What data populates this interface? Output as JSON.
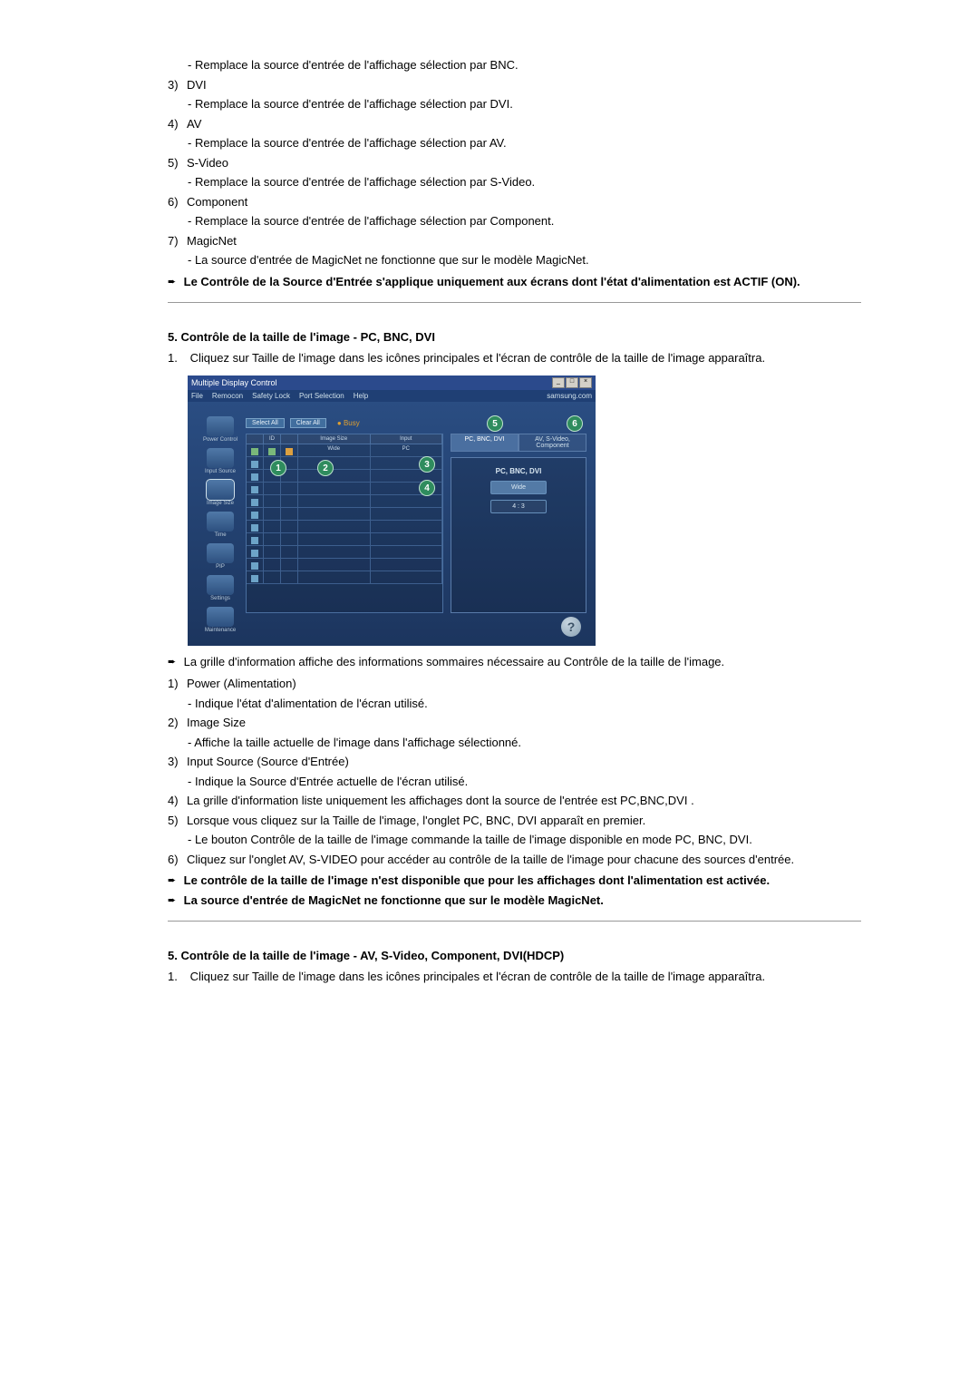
{
  "section_a": {
    "items": [
      {
        "num": "",
        "label": "",
        "sub": "Remplace la source d'entrée de l'affichage sélection par BNC."
      },
      {
        "num": "3)",
        "label": "DVI",
        "sub": "Remplace la source d'entrée de l'affichage sélection par DVI."
      },
      {
        "num": "4)",
        "label": "AV",
        "sub": "Remplace la source d'entrée de l'affichage sélection par AV."
      },
      {
        "num": "5)",
        "label": "S-Video",
        "sub": "Remplace la source d'entrée de l'affichage sélection par S-Video."
      },
      {
        "num": "6)",
        "label": "Component",
        "sub": "Remplace la source d'entrée de l'affichage sélection par Component."
      },
      {
        "num": "7)",
        "label": "MagicNet",
        "sub": "La source d'entrée de MagicNet ne fonctionne que sur le modèle MagicNet."
      }
    ],
    "note": "Le Contrôle de la Source d'Entrée s'applique uniquement aux écrans dont l'état d'alimentation est ACTIF (ON)."
  },
  "section_b": {
    "title": "5. Contrôle de la taille de l'image - PC, BNC, DVI",
    "intro_num": "1.",
    "intro": "Cliquez sur Taille de l'image dans les icônes principales et l'écran de contrôle de la taille de l'image apparaîtra.",
    "posttext_arrow": "La grille d'information affiche des informations sommaires nécessaire au Contrôle de la taille de l'image.",
    "items": [
      {
        "num": "1)",
        "label": "Power (Alimentation)",
        "sub": "Indique l'état d'alimentation de l'écran utilisé."
      },
      {
        "num": "2)",
        "label": "Image Size",
        "sub": "Affiche la taille actuelle de l'image dans l'affichage sélectionné."
      },
      {
        "num": "3)",
        "label": "Input Source (Source d'Entrée)",
        "sub": "Indique la Source d'Entrée actuelle de l'écran utilisé."
      },
      {
        "num": "4)",
        "label": "La grille d'information liste uniquement les affichages dont la source de l'entrée est PC,BNC,DVI .",
        "sub": ""
      },
      {
        "num": "5)",
        "label": "Lorsque vous cliquez sur la Taille de l'image, l'onglet PC, BNC, DVI apparaît en premier.",
        "sub": "Le bouton Contrôle de la taille de l'image commande la taille de l'image disponible en mode PC, BNC, DVI."
      },
      {
        "num": "6)",
        "label": "Cliquez sur l'onglet AV, S-VIDEO pour accéder au contrôle de la taille de l'image pour chacune des sources d'entrée.",
        "sub": ""
      }
    ],
    "note1": "Le contrôle de la taille de l'image n'est disponible que pour les affichages dont l'alimentation est activée.",
    "note2": "La source d'entrée de MagicNet ne fonctionne que sur le modèle MagicNet."
  },
  "section_c": {
    "title": "5. Contrôle de la taille de l'image - AV, S-Video, Component, DVI(HDCP)",
    "intro_num": "1.",
    "intro": "Cliquez sur Taille de l'image dans les icônes principales et l'écran de contrôle de la taille de l'image apparaîtra."
  },
  "mock": {
    "title": "Multiple Display Control",
    "menu": [
      "File",
      "Remocon",
      "Safety Lock",
      "Port Selection",
      "Help"
    ],
    "brand": "samsung.com",
    "sidebar": [
      "Power Control",
      "Input Source",
      "Image Size",
      "Time",
      "PIP",
      "Settings",
      "Maintenance"
    ],
    "toolbar": {
      "select_all": "Select All",
      "clear_all": "Clear All",
      "busy": "Busy"
    },
    "grid_headers": {
      "c1": "",
      "c2": "ID",
      "c3": "",
      "c4": "Image Size",
      "c5": "Input"
    },
    "grid_row1": {
      "size": "Wide",
      "input": "PC"
    },
    "tabs": {
      "a": "PC, BNC, DVI",
      "b": "AV, S-Video, Component"
    },
    "panel": {
      "title": "PC, BNC, DVI",
      "opt1": "Wide",
      "opt2": "4 : 3"
    },
    "callouts": {
      "c1": "1",
      "c2": "2",
      "c3": "3",
      "c4": "4",
      "c5": "5",
      "c6": "6"
    },
    "help": "?"
  }
}
